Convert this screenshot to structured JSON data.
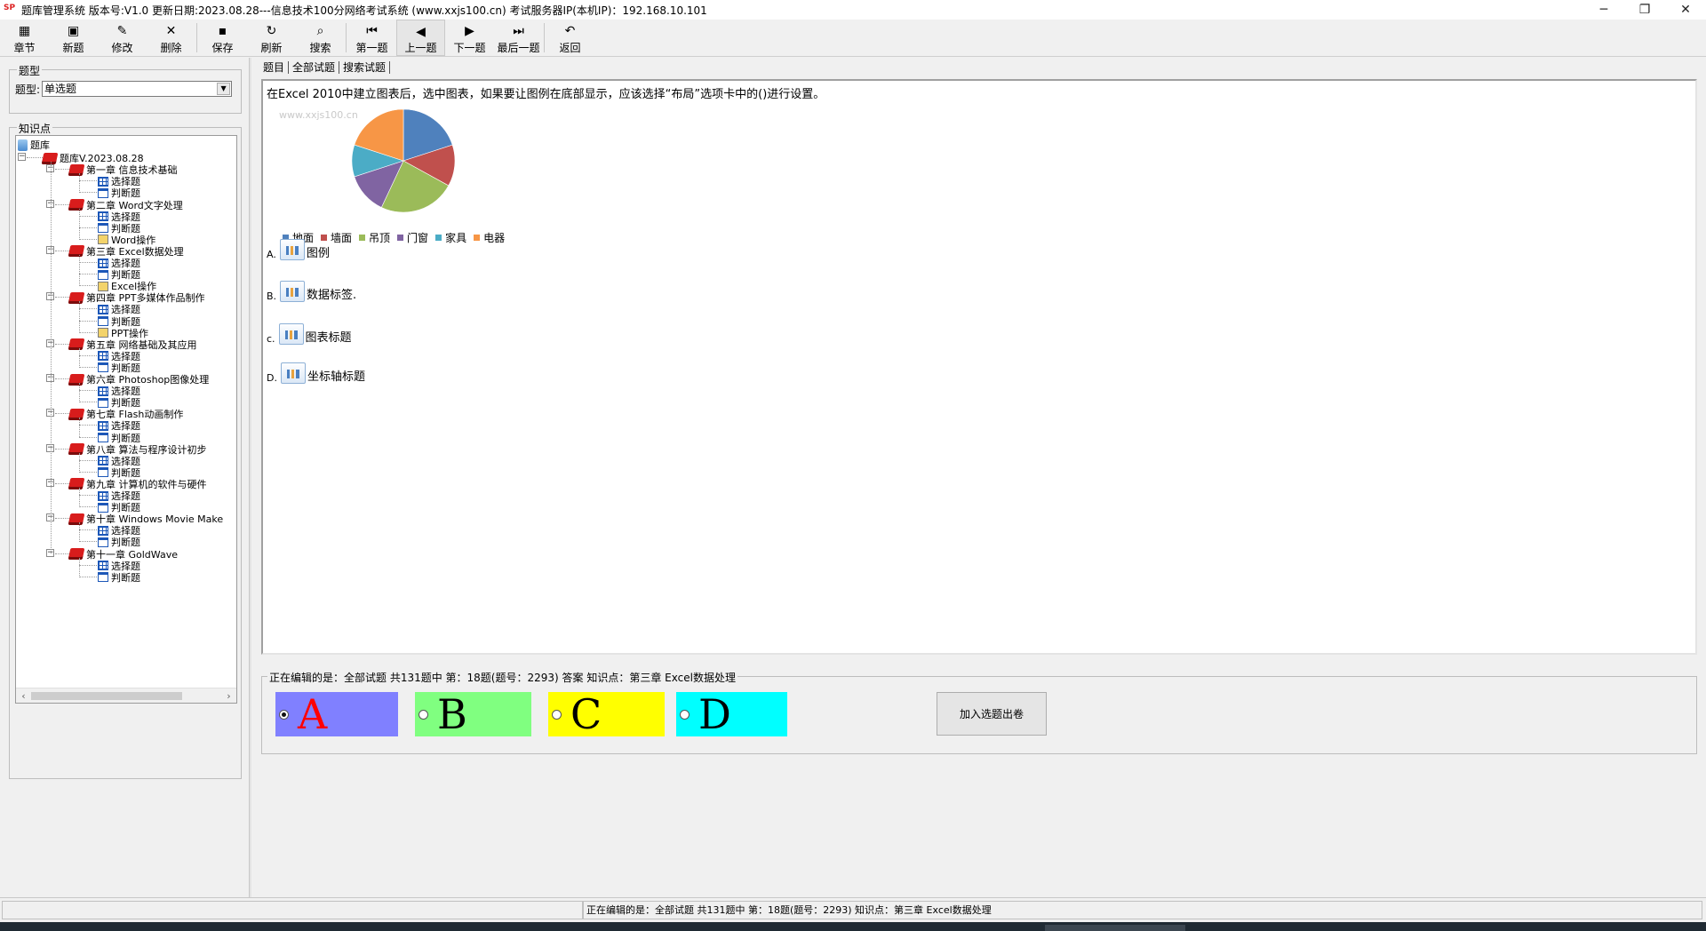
{
  "window": {
    "title": "题库管理系统 版本号:V1.0 更新日期:2023.08.28---信息技术100分网络考试系统    (www.xxjs100.cn)     考试服务器IP(本机IP)：192.168.10.101",
    "minimize": "─",
    "maximize": "❐",
    "close": "✕"
  },
  "toolbar": [
    {
      "id": "chapter",
      "label": "章节",
      "icon": "chapter-icon",
      "glyph": "▦"
    },
    {
      "id": "new",
      "label": "新题",
      "icon": "new-icon",
      "glyph": "▣"
    },
    {
      "id": "edit",
      "label": "修改",
      "icon": "edit-icon",
      "glyph": "✎"
    },
    {
      "id": "delete",
      "label": "删除",
      "icon": "delete-icon",
      "glyph": "✕"
    },
    {
      "id": "save",
      "label": "保存",
      "icon": "save-icon",
      "glyph": "▪"
    },
    {
      "id": "refresh",
      "label": "刷新",
      "icon": "refresh-icon",
      "glyph": "↻"
    },
    {
      "id": "search",
      "label": "搜索",
      "icon": "search-icon",
      "glyph": "⌕"
    },
    {
      "id": "first",
      "label": "第一题",
      "icon": "first-icon",
      "glyph": "⏮"
    },
    {
      "id": "prev",
      "label": "上一题",
      "icon": "prev-icon",
      "glyph": "◀"
    },
    {
      "id": "next",
      "label": "下一题",
      "icon": "next-icon",
      "glyph": "▶"
    },
    {
      "id": "last",
      "label": "最后一题",
      "icon": "last-icon",
      "glyph": "⏭"
    },
    {
      "id": "back",
      "label": "返回",
      "icon": "back-icon",
      "glyph": "↶"
    }
  ],
  "type_group": {
    "legend": "题型",
    "label": "题型:",
    "selected": "单选题"
  },
  "kp_group": {
    "legend": "知识点"
  },
  "tree": {
    "root": "题库",
    "bank": "题库V.2023.08.28",
    "chapters": [
      {
        "name": "第一章 信息技术基础",
        "items": [
          "选择题",
          "判断题"
        ]
      },
      {
        "name": "第二章 Word文字处理",
        "items": [
          "选择题",
          "判断题",
          "Word操作"
        ]
      },
      {
        "name": "第三章 Excel数据处理",
        "items": [
          "选择题",
          "判断题",
          "Excel操作"
        ]
      },
      {
        "name": "第四章 PPT多媒体作品制作",
        "items": [
          "选择题",
          "判断题",
          "PPT操作"
        ]
      },
      {
        "name": "第五章 网络基础及其应用",
        "items": [
          "选择题",
          "判断题"
        ]
      },
      {
        "name": "第六章 Photoshop图像处理",
        "items": [
          "选择题",
          "判断题"
        ]
      },
      {
        "name": "第七章 Flash动画制作",
        "items": [
          "选择题",
          "判断题"
        ]
      },
      {
        "name": "第八章 算法与程序设计初步",
        "items": [
          "选择题",
          "判断题"
        ]
      },
      {
        "name": "第九章 计算机的软件与硬件",
        "items": [
          "选择题",
          "判断题"
        ]
      },
      {
        "name": "第十章 Windows Movie Make",
        "items": [
          "选择题",
          "判断题"
        ]
      },
      {
        "name": "第十一章 GoldWave",
        "items": [
          "选择题",
          "判断题"
        ]
      }
    ]
  },
  "tabs": [
    "题目",
    "全部试题",
    "搜索试题"
  ],
  "question": {
    "text": "在Excel 2010中建立图表后，选中图表，如果要让图例在底部显示，应该选择“布局”选项卡中的()进行设置。",
    "watermark": "www.xxjs100.cn",
    "options": [
      {
        "letter": "A.",
        "text": "图例"
      },
      {
        "letter": "B.",
        "text": "数据标签."
      },
      {
        "letter": "c.",
        "text": "图表标题"
      },
      {
        "letter": "D.",
        "text": "坐标轴标题"
      }
    ]
  },
  "chart_data": {
    "type": "pie",
    "categories": [
      "地面",
      "墙面",
      "吊顶",
      "门窗",
      "家具",
      "电器"
    ],
    "values": [
      20,
      13,
      24,
      13,
      10,
      20
    ],
    "colors": [
      "#4f81bd",
      "#c0504d",
      "#9bbb59",
      "#8064a2",
      "#4bacc6",
      "#f79646"
    ]
  },
  "status_group": {
    "legend": "正在编辑的是：全部试题 共131题中  第：18题(题号：2293) 答案 知识点：第三章 Excel数据处理",
    "answers": [
      {
        "letter": "A",
        "color": "#8080ff",
        "letter_color": "#ff0000",
        "checked": true
      },
      {
        "letter": "B",
        "color": "#80ff80",
        "letter_color": "#000000",
        "checked": false
      },
      {
        "letter": "C",
        "color": "#ffff00",
        "letter_color": "#000000",
        "checked": false
      },
      {
        "letter": "D",
        "color": "#00ffff",
        "letter_color": "#000000",
        "checked": false
      }
    ],
    "add_button": "加入选题出卷"
  },
  "statusbar": {
    "right_text": "正在编辑的是：全部试题 共131题中  第：18题(题号：2293)  知识点：第三章 Excel数据处理"
  }
}
